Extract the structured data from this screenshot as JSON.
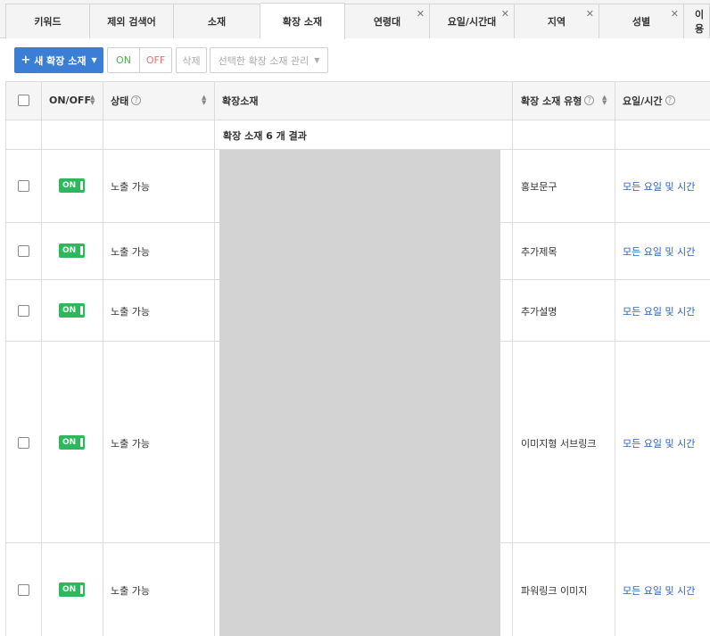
{
  "tabs": [
    {
      "label": "키워드",
      "closable": false
    },
    {
      "label": "제외 검색어",
      "closable": false
    },
    {
      "label": "소재",
      "closable": false
    },
    {
      "label": "확장 소재",
      "closable": false,
      "active": true
    },
    {
      "label": "연령대",
      "closable": true
    },
    {
      "label": "요일/시간대",
      "closable": true
    },
    {
      "label": "지역",
      "closable": true
    },
    {
      "label": "성별",
      "closable": true
    },
    {
      "label": "이용",
      "closable": false
    }
  ],
  "toolbar": {
    "new_label": "새 확장 소재",
    "on_label": "ON",
    "off_label": "OFF",
    "delete_label": "삭제",
    "manage_label": "선택한 확장 소재 관리"
  },
  "table": {
    "headers": {
      "onoff": "ON/OFF",
      "status": "상태",
      "extension": "확장소재",
      "type": "확장 소재 유형",
      "schedule": "요일/시간"
    },
    "summary": "확장 소재 6 개 결과",
    "rows": [
      {
        "toggle": "ON",
        "status": "노출 가능",
        "type": "홍보문구",
        "schedule": "모든 요일 및 시간"
      },
      {
        "toggle": "ON",
        "status": "노출 가능",
        "type": "추가제목",
        "schedule": "모든 요일 및 시간"
      },
      {
        "toggle": "ON",
        "status": "노출 가능",
        "type": "추가설명",
        "schedule": "모든 요일 및 시간"
      },
      {
        "toggle": "ON",
        "status": "노출 가능",
        "type": "이미지형 서브링크",
        "schedule": "모든 요일 및 시간"
      },
      {
        "toggle": "ON",
        "status": "노출 가능",
        "type": "파워링크 이미지",
        "schedule": "모든 요일 및 시간"
      }
    ]
  },
  "colors": {
    "primary_button": "#3a7fd5",
    "toggle_on": "#2eb85c",
    "link": "#2a63b8"
  }
}
